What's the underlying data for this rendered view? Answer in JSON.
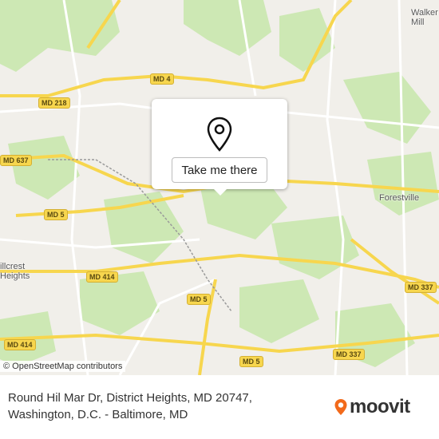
{
  "map": {
    "place_labels": [
      {
        "id": "walker-mill",
        "text": "Walker\nMill"
      },
      {
        "id": "forestville",
        "text": "Forestville"
      },
      {
        "id": "hillcrest-heights",
        "text": "illcrest\nHeights"
      }
    ],
    "road_shields": [
      {
        "id": "md4",
        "text": "MD 4"
      },
      {
        "id": "md218",
        "text": "MD 218"
      },
      {
        "id": "md637",
        "text": "MD 637"
      },
      {
        "id": "md5-west",
        "text": "MD 5"
      },
      {
        "id": "md414-a",
        "text": "MD 414"
      },
      {
        "id": "md414-b",
        "text": "MD 414"
      },
      {
        "id": "md5-south",
        "text": "MD 5"
      },
      {
        "id": "md5-bottom",
        "text": "MD 5"
      },
      {
        "id": "md337-east",
        "text": "MD 337"
      },
      {
        "id": "md337-bottom",
        "text": "MD 337"
      }
    ],
    "attribution": "© OpenStreetMap contributors",
    "colors": {
      "land": "#f1efea",
      "park": "#cde8b4",
      "highway": "#f7d64e",
      "road": "#ffffff",
      "rail": "#9a9a9a",
      "pin": "#f26a1b"
    }
  },
  "popup": {
    "pin_icon": "location-pin-icon",
    "button_label": "Take me there"
  },
  "footer": {
    "address": "Round Hil Mar Dr, District Heights, MD 20747, Washington, D.C. - Baltimore, MD",
    "brand": "moovit",
    "brand_color": "#f26a1b"
  }
}
